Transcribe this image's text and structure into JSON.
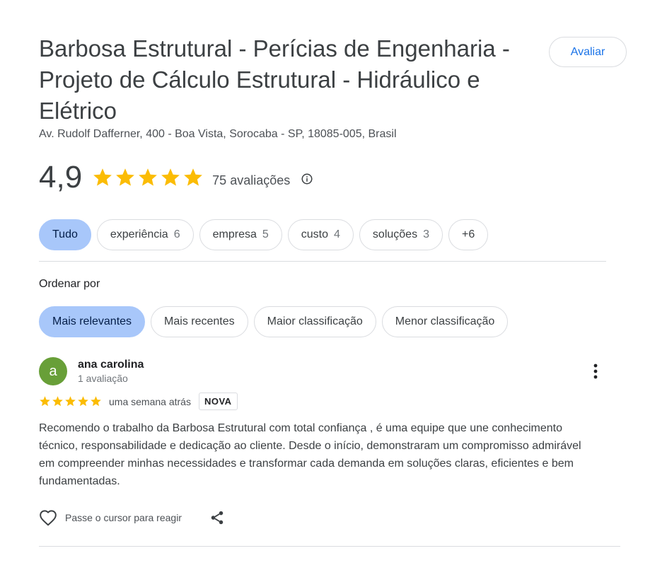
{
  "place": {
    "title": "Barbosa Estrutural - Perícias de Engenharia - Projeto de Cálculo Estrutural - Hidráulico e Elétrico",
    "address": "Av. Rudolf Dafferner, 400 - Boa Vista, Sorocaba - SP, 18085-005, Brasil",
    "rate_button_label": "Avaliar"
  },
  "rating": {
    "value": "4,9",
    "stars": 5,
    "count_label": "75 avaliações",
    "star_color": "#fbbc04"
  },
  "topics": [
    {
      "label": "Tudo",
      "count": "",
      "active": true
    },
    {
      "label": "experiência",
      "count": "6",
      "active": false
    },
    {
      "label": "empresa",
      "count": "5",
      "active": false
    },
    {
      "label": "custo",
      "count": "4",
      "active": false
    },
    {
      "label": "soluções",
      "count": "3",
      "active": false
    },
    {
      "label": "+6",
      "count": "",
      "active": false
    }
  ],
  "sort": {
    "label": "Ordenar por",
    "options": [
      {
        "label": "Mais relevantes",
        "active": true
      },
      {
        "label": "Mais recentes",
        "active": false
      },
      {
        "label": "Maior classificação",
        "active": false
      },
      {
        "label": "Menor classificação",
        "active": false
      }
    ]
  },
  "review": {
    "avatar_letter": "a",
    "avatar_color": "#689f38",
    "reviewer_name": "ana carolina",
    "reviewer_meta": "1 avaliação",
    "stars": 5,
    "date": "uma semana atrás",
    "badge": "NOVA",
    "text": "Recomendo o trabalho da Barbosa Estrutural com total confiança , é uma equipe que une conhecimento técnico, responsabilidade e dedicação ao cliente. Desde o início, demonstraram um compromisso admirável em compreender minhas necessidades e transformar cada demanda em soluções claras, eficientes e bem fundamentadas.",
    "react_hint": "Passe o cursor para reagir"
  },
  "accent_color": "#1a73e8",
  "active_chip_color": "#a8c7fa"
}
